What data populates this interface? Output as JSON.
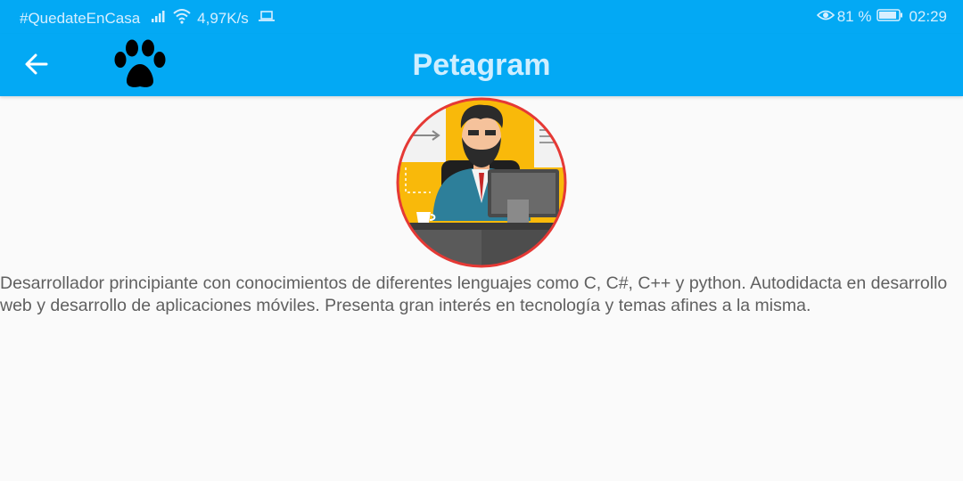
{
  "status_bar": {
    "carrier": "#QuedateEnCasa",
    "net_speed": "4,97K/s",
    "battery_pct": "81 %",
    "time": "02:29",
    "icons": [
      "signal-icon",
      "wifi-icon",
      "laptop-icon",
      "eye-icon",
      "battery-icon"
    ]
  },
  "toolbar": {
    "title": "Petagram",
    "back_icon": "arrow-left-icon",
    "logo_icon": "paw-icon"
  },
  "profile": {
    "avatar_icon": "developer-avatar",
    "bio": "Desarrollador principiante con conocimientos de diferentes lenguajes como C, C#, C++ y python. Autodidacta en desarrollo web y desarrollo de aplicaciones móviles. Presenta gran interés en tecnología y temas afines a la misma."
  },
  "colors": {
    "primary": "#03a9f4",
    "title_text": "#cfeeff",
    "avatar_border": "#e53935",
    "avatar_bg": "#f9b90a",
    "body_text": "#606060"
  }
}
